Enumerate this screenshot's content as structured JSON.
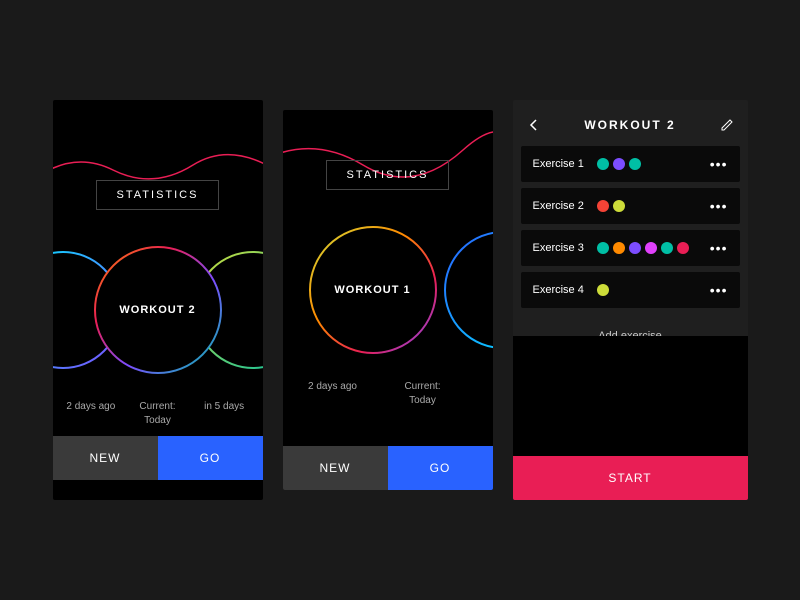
{
  "colors": {
    "blue": "#2962ff",
    "pink": "#e91e55",
    "green": "#00bfa5",
    "orange": "#ff8a00",
    "purple": "#7c4dff",
    "yellow": "#cddc39",
    "red": "#f44336",
    "cyan": "#00e5ff",
    "magenta": "#e040fb"
  },
  "screen1": {
    "statistics": "STATISTICS",
    "workout": "WORKOUT 2",
    "dates": [
      "2 days ago",
      "Current: Today",
      "in 5 days"
    ],
    "new": "NEW",
    "go": "GO"
  },
  "screen2": {
    "statistics": "STATISTICS",
    "workout": "WORKOUT 1",
    "dates": [
      "2 days ago",
      "Current: Today"
    ],
    "new": "NEW",
    "go": "GO"
  },
  "screen3": {
    "title": "WORKOUT 2",
    "exercises": [
      {
        "name": "Exercise 1",
        "colors": [
          "#00bfa5",
          "#7c4dff",
          "#00bfa5"
        ]
      },
      {
        "name": "Exercise 2",
        "colors": [
          "#f44336",
          "#cddc39"
        ]
      },
      {
        "name": "Exercise 3",
        "colors": [
          "#00bfa5",
          "#ff8a00",
          "#7c4dff",
          "#e040fb",
          "#00bfa5",
          "#e91e55"
        ]
      },
      {
        "name": "Exercise 4",
        "colors": [
          "#cddc39"
        ]
      }
    ],
    "add": "Add exercise",
    "start": "START"
  }
}
